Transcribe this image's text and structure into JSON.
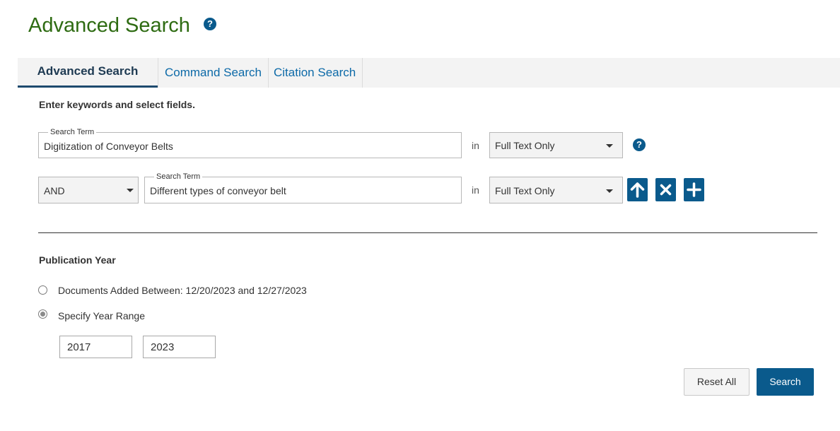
{
  "page": {
    "title": "Advanced Search"
  },
  "tabs": [
    {
      "label": "Advanced Search",
      "active": true
    },
    {
      "label": "Command Search",
      "active": false
    },
    {
      "label": "Citation Search",
      "active": false
    }
  ],
  "instructions": "Enter keywords and select fields.",
  "rows": [
    {
      "legend": "Search Term",
      "value": "Digitization of Conveyor Belts",
      "in_label": "in",
      "field": "Full Text Only"
    },
    {
      "operator": "AND",
      "legend": "Search Term",
      "value": "Different types of conveyor belt",
      "in_label": "in",
      "field": "Full Text Only"
    }
  ],
  "publication_year": {
    "label": "Publication Year",
    "options": [
      {
        "label": "Documents Added Between: 12/20/2023 and 12/27/2023",
        "selected": false
      },
      {
        "label": "Specify Year Range",
        "selected": true
      }
    ],
    "from": "2017",
    "to": "2023"
  },
  "buttons": {
    "reset": "Reset All",
    "search": "Search"
  },
  "help_glyph": "?",
  "colors": {
    "title_green": "#2e6b12",
    "link_blue": "#0d6aa8",
    "button_blue": "#0a5a8c"
  }
}
